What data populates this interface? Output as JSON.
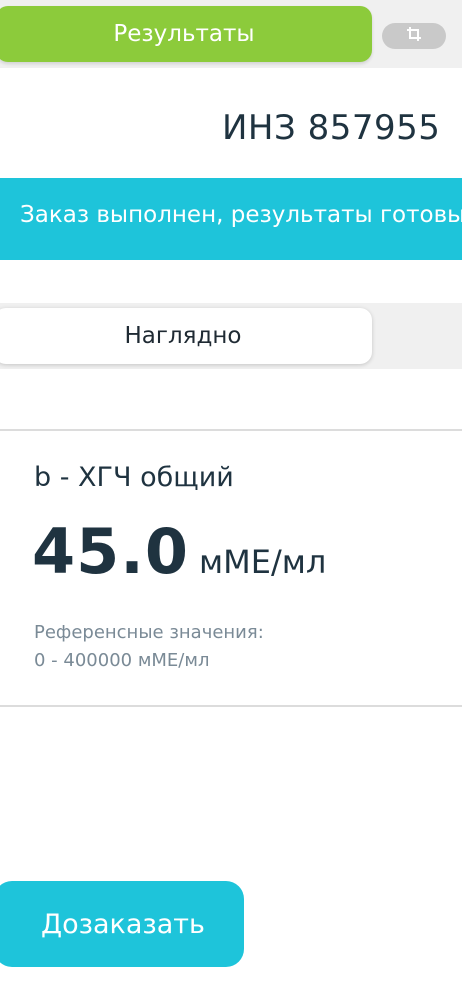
{
  "tabs": {
    "results_label": "Результаты",
    "crop_icon": "crop-icon"
  },
  "order": {
    "number": "ИНЗ 857955"
  },
  "status": {
    "text": "Заказ выполнен, результаты готовы"
  },
  "view": {
    "active_label": "Наглядно"
  },
  "result": {
    "test_name": "b - ХГЧ общий",
    "value": "45.0",
    "unit": "мМЕ/мл",
    "reference_label": "Референсные значения:",
    "reference_range": "0 - 400000 мМЕ/мл"
  },
  "actions": {
    "reorder_label": "Дозаказать"
  },
  "colors": {
    "accent_green": "#8ccb3b",
    "accent_cyan": "#1ec4da",
    "text_dark": "#1f3340",
    "text_muted": "#7a8a96"
  }
}
